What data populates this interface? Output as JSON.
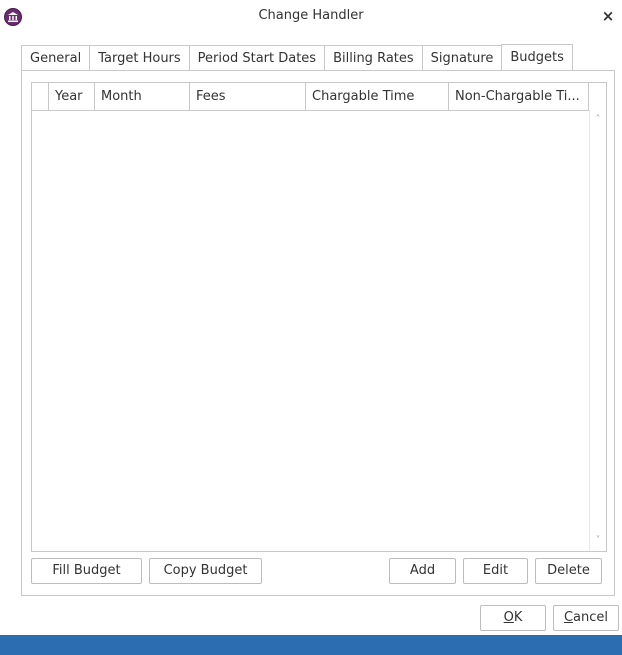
{
  "window": {
    "title": "Change Handler",
    "close_glyph": "×",
    "icon": "institution-icon",
    "accent_color": "#6a2c70",
    "taskbar_color": "#2c6cb0"
  },
  "tabs": [
    {
      "label": "General"
    },
    {
      "label": "Target Hours"
    },
    {
      "label": "Period Start Dates"
    },
    {
      "label": "Billing Rates"
    },
    {
      "label": "Signature"
    },
    {
      "label": "Budgets",
      "active": true
    }
  ],
  "grid": {
    "columns": [
      "Year",
      "Month",
      "Fees",
      "Chargable Time",
      "Non-Chargable Ti..."
    ],
    "rows": [],
    "scroll_up_glyph": "˄",
    "scroll_down_glyph": "˅"
  },
  "panel_buttons": {
    "fill_budget": "Fill Budget",
    "copy_budget": "Copy Budget",
    "add": "Add",
    "edit": "Edit",
    "delete": "Delete"
  },
  "dialog_buttons": {
    "ok_mnemonic": "O",
    "ok_rest": "K",
    "cancel_mnemonic": "C",
    "cancel_rest": "ancel"
  }
}
